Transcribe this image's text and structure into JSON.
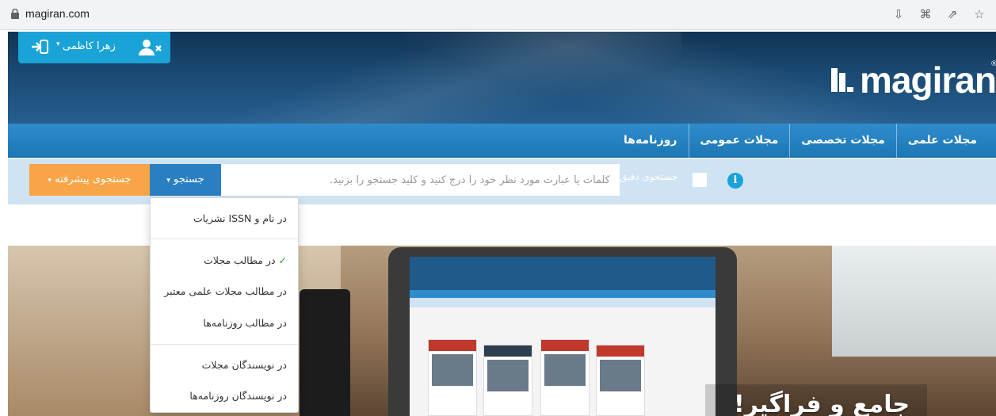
{
  "browser": {
    "url": "magiran.com",
    "icons": [
      "install-icon",
      "translate-icon",
      "share-icon",
      "bookmark-star-icon"
    ]
  },
  "header": {
    "user_name": "زهرا کاظمی",
    "logo_text": "magiran",
    "logo_reg": "®"
  },
  "nav": {
    "items": [
      {
        "label": "مجلات علمی"
      },
      {
        "label": "مجلات تخصصی"
      },
      {
        "label": "مجلات عمومی"
      },
      {
        "label": "روزنامه‌ها"
      }
    ]
  },
  "search": {
    "placeholder": "کلمات یا عبارت مورد نظر خود را درج کنید و کلید جستجو را بزنید.",
    "search_button": "جستجو",
    "advanced_button": "جستجوی پیشرفته",
    "exact_label": "جستجوی دقیق",
    "exact_checked": false
  },
  "dropdown": {
    "items": [
      {
        "label": "در نام و ISSN نشریات",
        "checked": false
      },
      {
        "label": "در مطالب مجلات",
        "checked": true,
        "check": "✓"
      },
      {
        "label": "در مطالب مجلات علمی معتبر",
        "checked": false
      },
      {
        "label": "در مطالب روزنامه‌ها",
        "checked": false
      },
      {
        "label": "در نویسندگان مجلات",
        "checked": false
      },
      {
        "label": "در نویسندگان روزنامه‌ها",
        "checked": false
      }
    ]
  },
  "hero": {
    "title": "جامع و فراگیر!"
  },
  "colors": {
    "accent_blue": "#2a7fc2",
    "accent_orange": "#f7a546",
    "header_dark": "#1b4a73",
    "user_box": "#1aa3d6"
  }
}
